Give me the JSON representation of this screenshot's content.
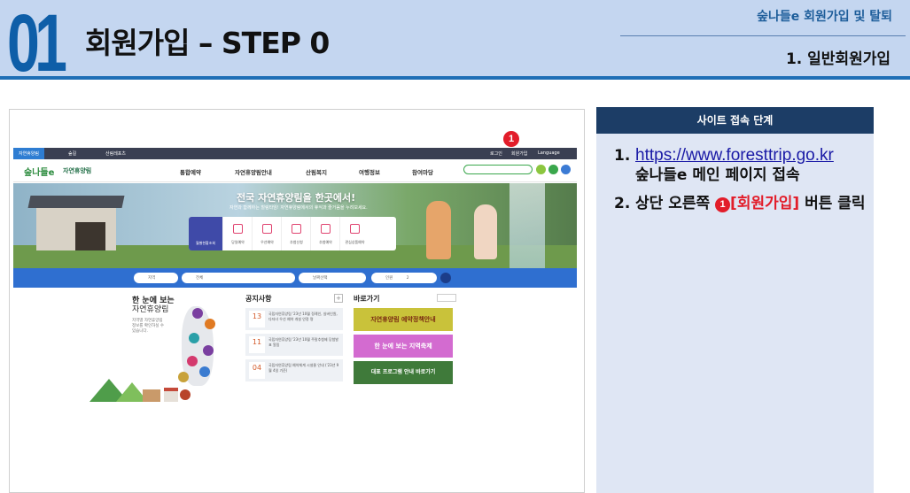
{
  "header": {
    "number": "01",
    "title": "회원가입 – STEP 0",
    "category": "숲나들e 회원가입 및 탈퇴",
    "section": "1. 일반회원가입"
  },
  "screenshot": {
    "marker": "1",
    "topbar": {
      "left_items": [
        "자연휴양림",
        "숲길",
        "산림레포츠"
      ],
      "right_items": [
        "로그인",
        "회원가입",
        "Language"
      ]
    },
    "nav": {
      "logo": "숲나들e",
      "logo_sub": "자연휴양림",
      "menu": [
        "통합예약",
        "자연휴양림안내",
        "산림복지",
        "여행정보",
        "참여마당"
      ]
    },
    "hero": {
      "title": "전국 자연휴양림을 한곳에서!",
      "subtitle": "자연과 함께하는 힐링타임! 자연휴양림에서의 휴식과 즐거움을 누려보세요.",
      "quick_first": "월별현황조회",
      "quick_items": [
        "당일예약",
        "우선예약",
        "추첨신청",
        "추첨예약",
        "관심상품예약"
      ]
    },
    "searchbar": {
      "fields": [
        "지역",
        "전체",
        "날짜선택",
        "인원",
        "2"
      ]
    },
    "map_section": {
      "title1": "한 눈에 보는",
      "title2": "자연휴양림",
      "desc": "지역별 자연휴양림 정보를 확인하실 수 있습니다."
    },
    "notice": {
      "title": "공지사항",
      "plus": "+",
      "items": [
        {
          "num": "13",
          "text": "국립자연휴양림 '23년 10월 정례인, 실버인원, 다자녀 우선 예약 개설 안정 명"
        },
        {
          "num": "11",
          "text": "국립자연휴양림 '23년 10월 주말추첨제 당첨발표 알림"
        },
        {
          "num": "04",
          "text": "국립자연휴양림 예약체계 시설물 안내 ('23년 9월 4일 기준)"
        }
      ]
    },
    "quicklinks": {
      "title": "바로가기",
      "banners": [
        "자연휴양림 예약정책안내",
        "한 눈에 보는 지역축제",
        "대표 프로그램 안내 바로가기"
      ]
    }
  },
  "panel": {
    "header": "사이트 접속 단계",
    "step1_num": "1.",
    "step1_link": "https://www.foresttrip.go.kr",
    "step1_text": "숲나들e 메인 페이지 접속",
    "step2_num": "2.",
    "step2_pre": "상단 오른쪽",
    "step2_marker": "1",
    "step2_highlight": "[회원가입]",
    "step2_post": "버튼 클릭"
  },
  "colors": {
    "header_bg": "#c4d6f0",
    "accent_blue": "#0e5ea8",
    "panel_header": "#1c3d66",
    "panel_bg": "#dfe6f4",
    "marker_red": "#e21d2a"
  }
}
